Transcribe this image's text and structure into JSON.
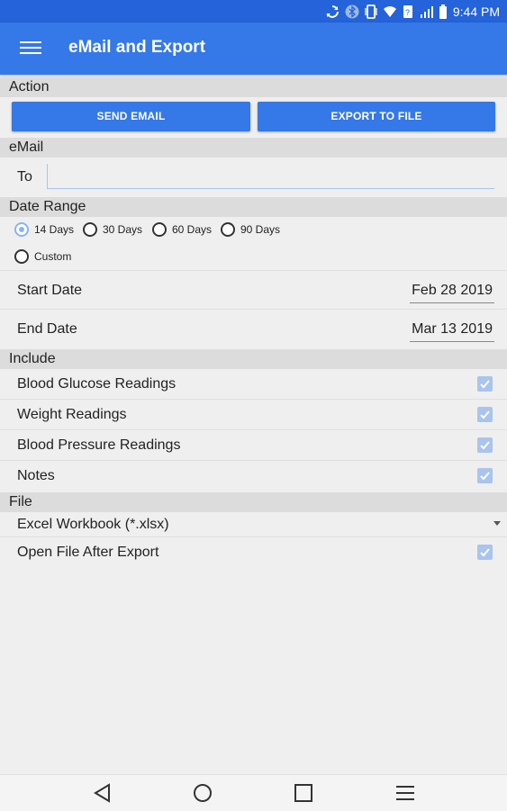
{
  "status_bar": {
    "time": "9:44 PM"
  },
  "app_bar": {
    "title": "eMail and Export"
  },
  "sections": {
    "action": "Action",
    "email": "eMail",
    "date_range": "Date Range",
    "include": "Include",
    "file": "File"
  },
  "action": {
    "send_email_label": "SEND EMAIL",
    "export_label": "EXPORT TO FILE"
  },
  "email": {
    "to_label": "To",
    "to_value": ""
  },
  "date_range": {
    "options": [
      "14 Days",
      "30 Days",
      "60 Days",
      "90 Days",
      "Custom"
    ],
    "selected": "14 Days",
    "start_label": "Start Date",
    "start_value": "Feb 28 2019",
    "end_label": "End Date",
    "end_value": "Mar 13 2019"
  },
  "include": {
    "items": [
      {
        "label": "Blood Glucose Readings",
        "checked": true
      },
      {
        "label": "Weight Readings",
        "checked": true
      },
      {
        "label": "Blood Pressure Readings",
        "checked": true
      },
      {
        "label": "Notes",
        "checked": true
      }
    ]
  },
  "file": {
    "format_value": "Excel Workbook (*.xlsx)",
    "open_after_label": "Open File After Export",
    "open_after_checked": true
  },
  "colors": {
    "status_bar": "#2463d9",
    "app_bar": "#3578e8",
    "accent_light": "#a9c4ee",
    "section_bg": "#dcdcdc"
  }
}
